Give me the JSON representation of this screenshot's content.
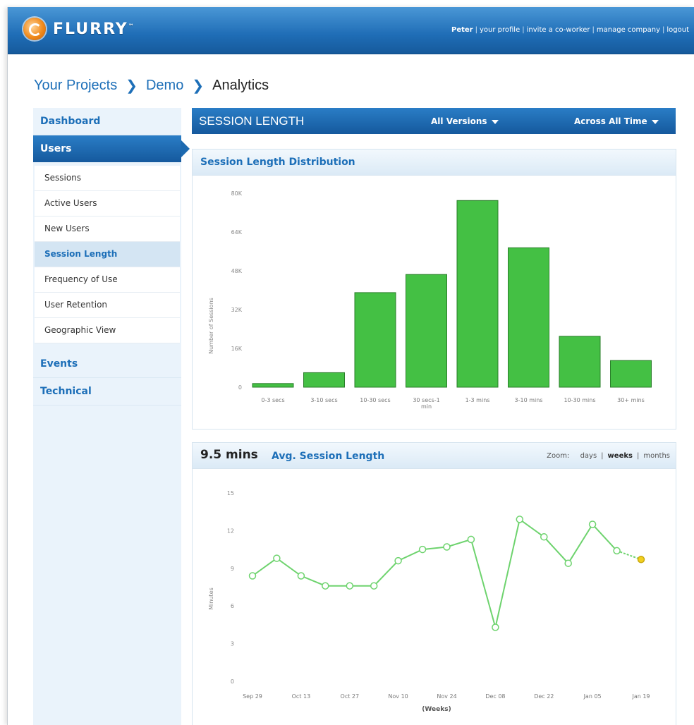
{
  "topbar": {
    "logo_text": "FLURRY",
    "logo_tm": "™",
    "user": "Peter",
    "links": [
      "your profile",
      "invite a co-worker",
      "manage company",
      "logout"
    ],
    "separator": "|"
  },
  "breadcrumb": {
    "items": [
      "Your Projects",
      "Demo"
    ],
    "current": "Analytics",
    "separator": ">"
  },
  "sidebar": {
    "top_item": "Dashboard",
    "active_item": "Users",
    "sub_items": [
      "Sessions",
      "Active Users",
      "New Users",
      "Session Length",
      "Frequency of Use",
      "User Retention",
      "Geographic View"
    ],
    "selected_sub_item": "Session Length",
    "bottom_items": [
      "Events",
      "Technical"
    ]
  },
  "header": {
    "title": "SESSION LENGTH",
    "versions_dropdown": "All Versions",
    "time_dropdown": "Across All Time"
  },
  "distribution_panel": {
    "title": "Session Length Distribution"
  },
  "avg_panel": {
    "value": "9.5 mins",
    "title": "Avg. Session Length",
    "zoom_label": "Zoom:",
    "zoom_options": [
      "days",
      "weeks",
      "months"
    ],
    "zoom_selected": "weeks"
  },
  "colors": {
    "bar_fill": "#44c044",
    "bar_stroke": "#2a7d2a",
    "line": "#6ed36e",
    "last_point": "#f2cf1f",
    "brand_blue": "#1d6fb8"
  },
  "chart_data": [
    {
      "type": "bar",
      "title": "Session Length Distribution",
      "ylabel": "Number of Sessions",
      "categories": [
        "0-3 secs",
        "3-10 secs",
        "10-30 secs",
        "30 secs-1 min",
        "1-3 mins",
        "3-10 mins",
        "10-30 mins",
        "30+ mins"
      ],
      "values": [
        1500,
        6000,
        39000,
        46500,
        77000,
        57500,
        21000,
        11000
      ],
      "ylim": [
        0,
        80000
      ],
      "ytick_labels": [
        "0",
        "16K",
        "32K",
        "48K",
        "64K",
        "80K"
      ],
      "grid": false
    },
    {
      "type": "line",
      "title": "Avg. Session Length",
      "ylabel": "Minutes",
      "xlabel": "(Weeks)",
      "x_tick_labels": [
        "Sep 29",
        "Oct 13",
        "Oct 27",
        "Nov 10",
        "Nov 24",
        "Dec 08",
        "Dec 22",
        "Jan 05",
        "Jan 19"
      ],
      "values": [
        8.4,
        9.8,
        8.4,
        7.6,
        7.6,
        7.6,
        9.6,
        10.5,
        10.7,
        11.3,
        4.3,
        12.9,
        11.5,
        9.4,
        12.5,
        10.4,
        9.7
      ],
      "ylim": [
        0,
        15
      ],
      "ytick_labels": [
        "0",
        "3",
        "6",
        "9",
        "12",
        "15"
      ],
      "last_point_projected": true,
      "grid": false
    }
  ]
}
